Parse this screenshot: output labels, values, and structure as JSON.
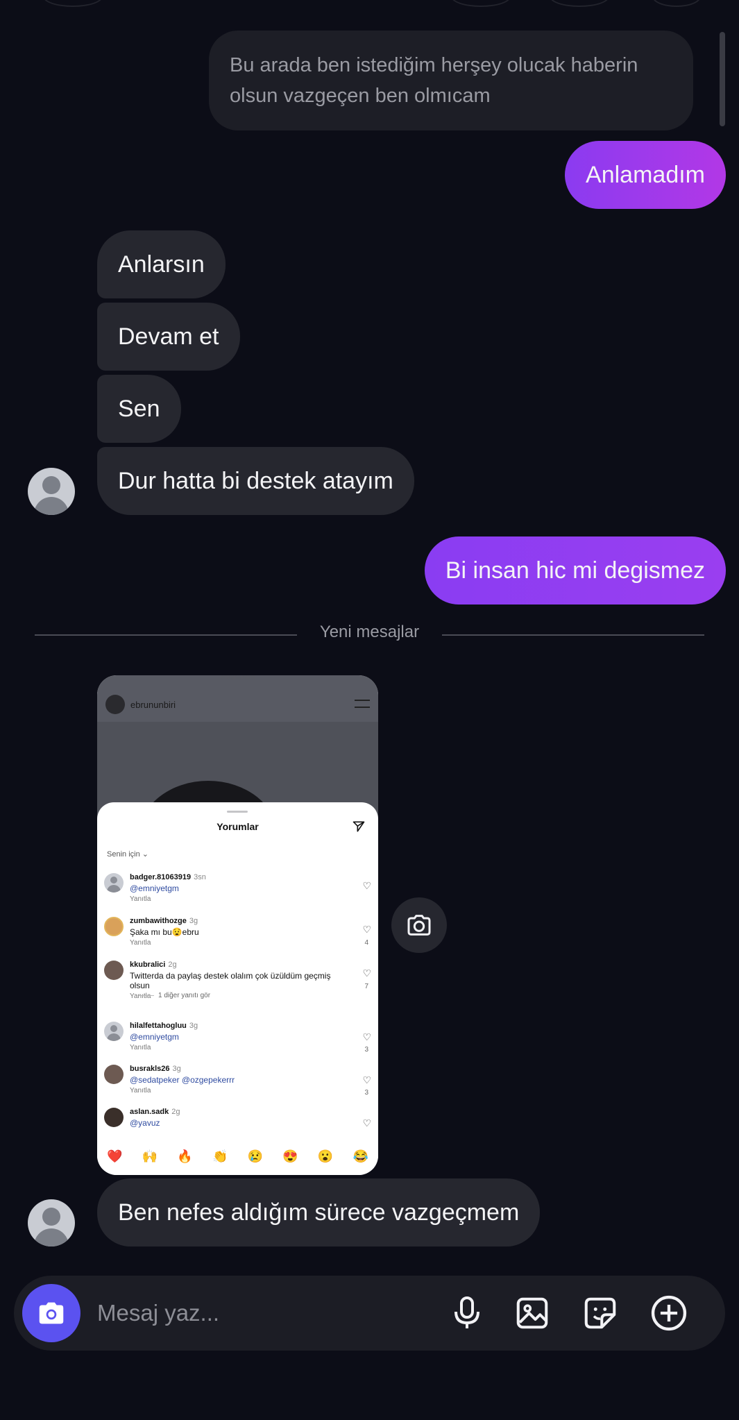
{
  "messages": {
    "m1": "Bu arada ben istediğim herşey olucak haberin olsun vazgeçen ben olmıcam",
    "m2": "Anlamadım",
    "m3": "Anlarsın",
    "m4": "Devam et",
    "m5": "Sen",
    "m6": "Dur hatta bi destek atayım",
    "m7": "Bi insan hic mi degismez",
    "m8": "Ben nefes aldığım sürece vazgeçmem"
  },
  "divider": {
    "label": "Yeni mesajlar"
  },
  "shared_screenshot": {
    "top_caption": "ebrununbiri",
    "username": "ebrununbiri",
    "sheet_title": "Yorumlar",
    "filter": "Senin için ⌄",
    "more_replies": "1 diğer yanıtı gör",
    "reply_label": "Yanıtla",
    "comments": [
      {
        "user": "badger.81063919",
        "time": "3sn",
        "text": "@emniyetgm",
        "likes": ""
      },
      {
        "user": "zumbawithozge",
        "time": "3g",
        "text": "Şaka mı bu😧ebru",
        "likes": "4"
      },
      {
        "user": "kkubralici",
        "time": "2g",
        "text": "Twitterda da paylaş destek olalım çok üzüldüm geçmiş olsun",
        "likes": "7"
      },
      {
        "user": "hilalfettahogluu",
        "time": "3g",
        "text": "@emniyetgm",
        "likes": "3"
      },
      {
        "user": "busrakls26",
        "time": "3g",
        "text": "@sedatpeker @ozgepekerrr",
        "likes": "3"
      },
      {
        "user": "aslan.sadk",
        "time": "2g",
        "text": "@yavuz",
        "likes": ""
      }
    ],
    "emojis": [
      "❤️",
      "🙌",
      "🔥",
      "👏",
      "😢",
      "😍",
      "😮",
      "😂"
    ]
  },
  "composer": {
    "placeholder": "Mesaj yaz..."
  },
  "icons": {
    "camera": "camera-icon",
    "mic": "microphone-icon",
    "gallery": "image-icon",
    "sticker": "sticker-icon",
    "plus": "plus-circle-icon",
    "send": "send-icon",
    "heart": "heart-icon"
  },
  "colors": {
    "background": "#0c0d17",
    "received_bubble": "#26272f",
    "sent_gradient_start": "#8b3bf0",
    "sent_gradient_end": "#b238e6",
    "camera_button": "#5b52f0"
  }
}
